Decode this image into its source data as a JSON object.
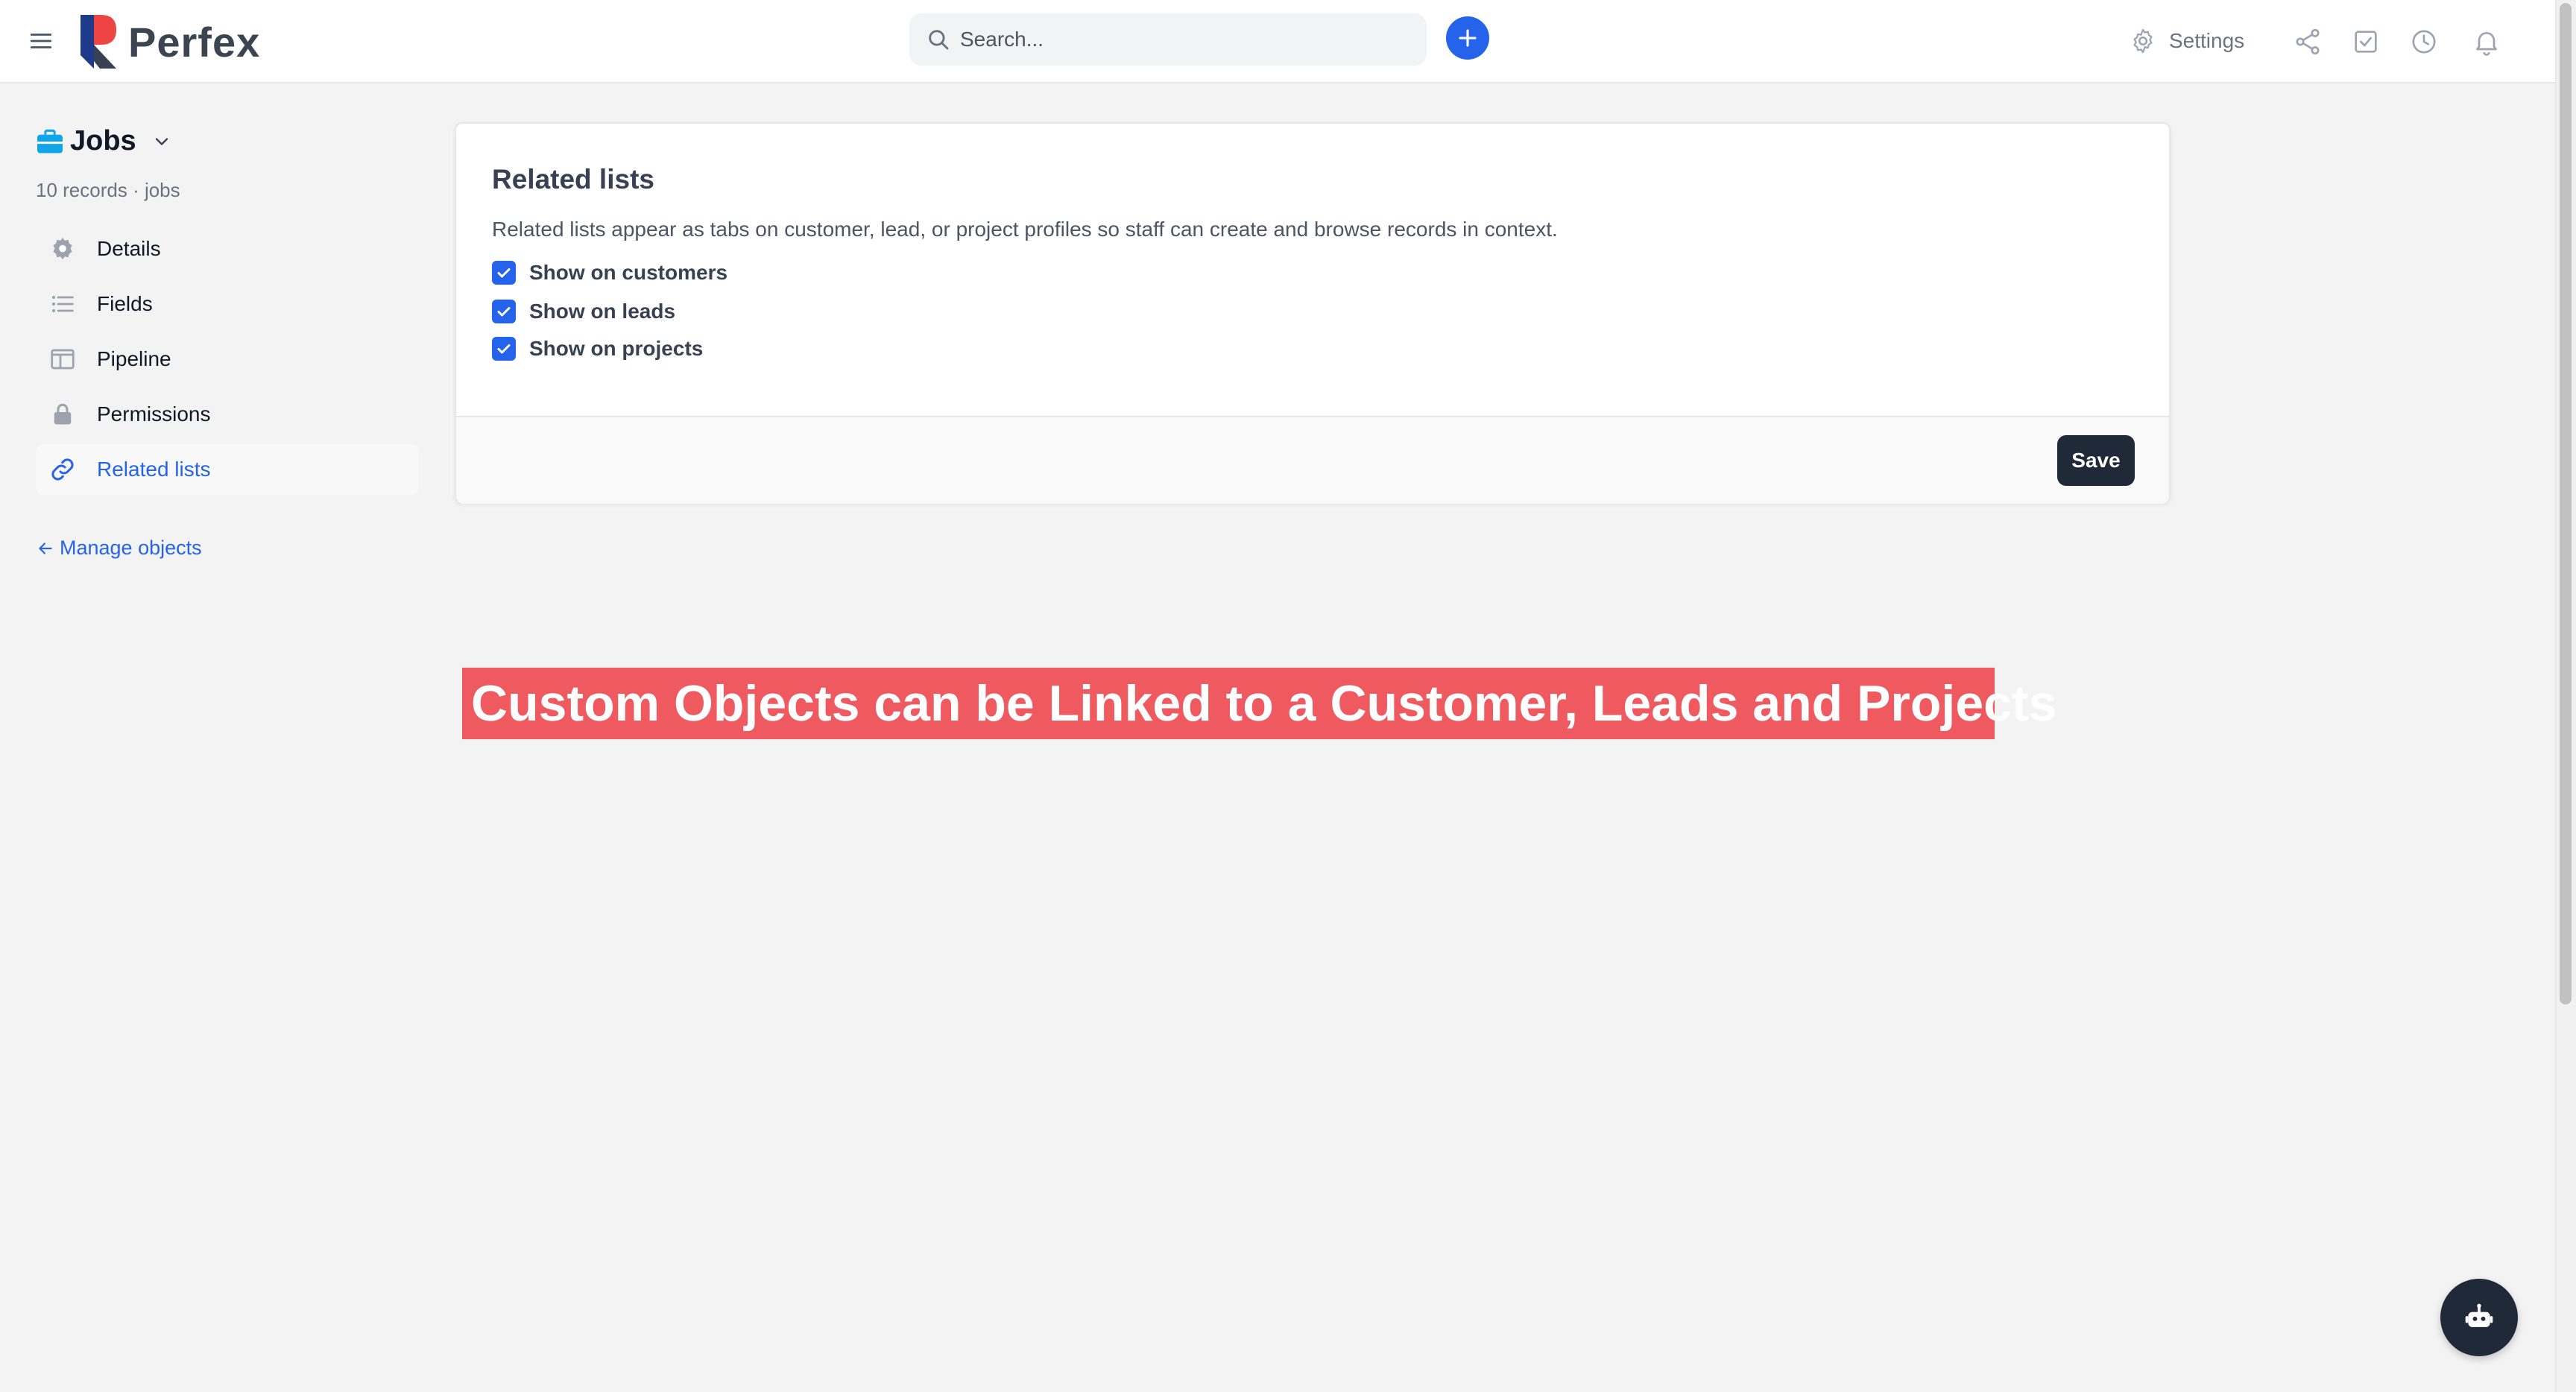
{
  "topbar": {
    "app_name": "Perfex",
    "search_placeholder": "Search...",
    "settings_label": "Settings",
    "icons": [
      "menu-icon",
      "search-icon",
      "plus-icon",
      "gear-icon",
      "share-icon",
      "checkbox-icon",
      "clock-icon",
      "bell-icon"
    ]
  },
  "sidebar": {
    "object_name": "Jobs",
    "object_meta": "10 records · jobs",
    "items": [
      {
        "label": "Details",
        "icon": "gear-icon"
      },
      {
        "label": "Fields",
        "icon": "list-icon"
      },
      {
        "label": "Pipeline",
        "icon": "columns-icon"
      },
      {
        "label": "Permissions",
        "icon": "lock-icon"
      },
      {
        "label": "Related lists",
        "icon": "link-icon",
        "active": true
      }
    ],
    "manage_link": "Manage objects"
  },
  "card": {
    "title": "Related lists",
    "description": "Related lists appear as tabs on customer, lead, or project profiles so staff can create and browse records in context.",
    "options": [
      {
        "label": "Show on customers",
        "checked": true
      },
      {
        "label": "Show on leads",
        "checked": true
      },
      {
        "label": "Show on projects",
        "checked": true
      }
    ],
    "save_label": "Save"
  },
  "banner": {
    "text": "Custom Objects can be Linked to a Customer, Leads and Projects"
  },
  "colors": {
    "accent": "#2563eb",
    "dark": "#1f2937",
    "banner": "#ee5a5f",
    "background": "#f3f3f3"
  }
}
